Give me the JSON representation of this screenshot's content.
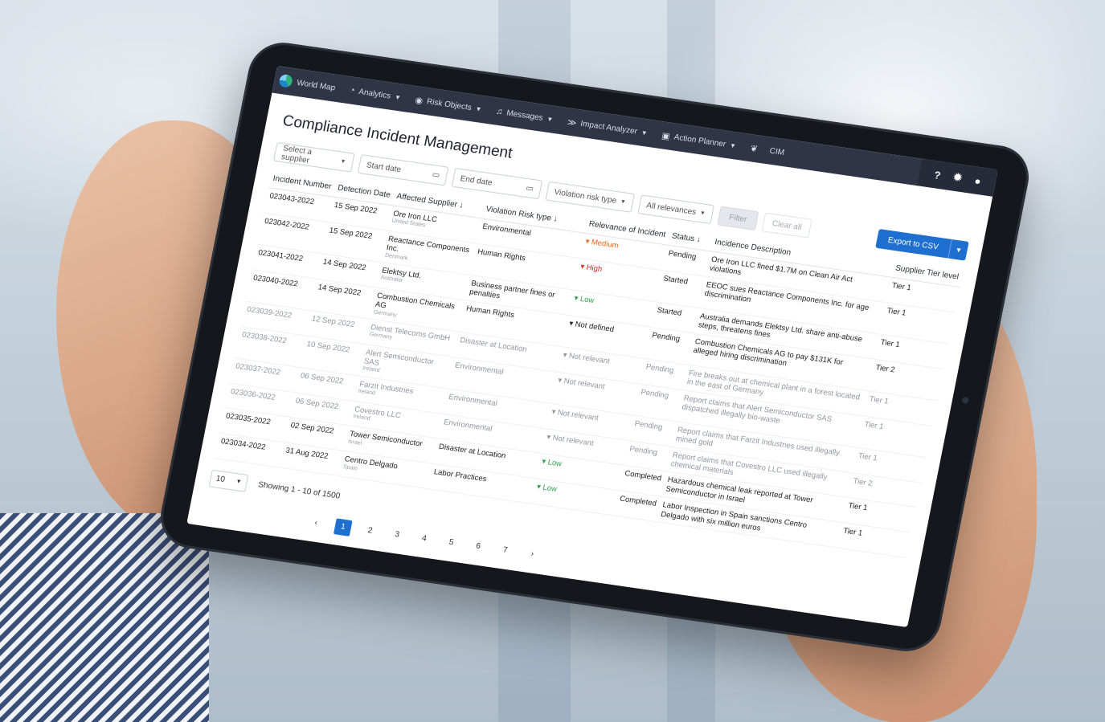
{
  "nav": {
    "items": [
      {
        "label": "World Map",
        "icon": "globe-logo",
        "caret": false
      },
      {
        "label": "Analytics",
        "icon": "pie-chart-icon",
        "caret": true
      },
      {
        "label": "Risk Objects",
        "icon": "eye-icon",
        "caret": true
      },
      {
        "label": "Messages",
        "icon": "bell-icon",
        "caret": true
      },
      {
        "label": "Impact Analyzer",
        "icon": "impact-icon",
        "caret": true
      },
      {
        "label": "Action Planner",
        "icon": "clipboard-icon",
        "caret": true
      },
      {
        "label": "CIM",
        "icon": "leaf-icon",
        "caret": false
      }
    ],
    "right_icons": [
      "help-icon",
      "settings-icon",
      "user-icon"
    ]
  },
  "page": {
    "title": "Compliance Incident Management"
  },
  "filters": {
    "supplier": "Select a supplier",
    "start_date": "Start date",
    "end_date": "End date",
    "violation_type": "Violation risk type",
    "relevance": "All relevances",
    "filter_button": "Filter",
    "clear_button": "Clear all",
    "export_button": "Export to CSV"
  },
  "table": {
    "columns": [
      "Incident Number",
      "Detection Date",
      "Affected Supplier",
      "Violation Risk type",
      "Relevance of Incident",
      "Status",
      "Incidence Description",
      "Supplier Tier level"
    ],
    "rows": [
      {
        "number": "023043-2022",
        "date": "15 Sep 2022",
        "supplier": "Ore Iron LLC",
        "country": "United States",
        "violation": "Environmental",
        "relevance": "Medium",
        "rel_class": "medium",
        "status": "Pending",
        "description": "Ore Iron LLC fined $1.7M on Clean Air Act violations",
        "tier": "Tier 1",
        "muted": false
      },
      {
        "number": "023042-2022",
        "date": "15 Sep 2022",
        "supplier": "Reactance Components Inc.",
        "country": "Denmark",
        "violation": "Human Rights",
        "relevance": "High",
        "rel_class": "high",
        "status": "Started",
        "description": "EEOC sues Reactance Components Inc. for age discrimination",
        "tier": "Tier 1",
        "muted": false
      },
      {
        "number": "023041-2022",
        "date": "14 Sep 2022",
        "supplier": "Elektsy Ltd.",
        "country": "Australia",
        "violation": "Business partner fines or penalties",
        "relevance": "Low",
        "rel_class": "low",
        "status": "Started",
        "description": "Australia demands Elektsy Ltd. share anti-abuse steps, threatens fines",
        "tier": "Tier 1",
        "muted": false
      },
      {
        "number": "023040-2022",
        "date": "14 Sep 2022",
        "supplier": "Combustion Chemicals AG",
        "country": "Germany",
        "violation": "Human Rights",
        "relevance": "Not defined",
        "rel_class": "",
        "status": "Pending",
        "description": "Combustion Chemicals AG to pay $131K for alleged hiring discrimination",
        "tier": "Tier 2",
        "muted": false
      },
      {
        "number": "023039-2022",
        "date": "12 Sep 2022",
        "supplier": "Dienst Telecoms GmbH",
        "country": "Germany",
        "violation": "Disaster at Location",
        "relevance": "Not relevant",
        "rel_class": "",
        "status": "Pending",
        "description": "Fire breaks out at chemical plant in a forest located in the east of Germany",
        "tier": "Tier 1",
        "muted": true
      },
      {
        "number": "023038-2022",
        "date": "10 Sep 2022",
        "supplier": "Alert Semiconductor SAS",
        "country": "Ireland",
        "violation": "Environmental",
        "relevance": "Not relevant",
        "rel_class": "",
        "status": "Pending",
        "description": "Report claims that Alert Semiconductor SAS dispatched illegally bio-waste",
        "tier": "Tier 1",
        "muted": true
      },
      {
        "number": "023037-2022",
        "date": "06 Sep 2022",
        "supplier": "Farzit Industries",
        "country": "Ireland",
        "violation": "Environmental",
        "relevance": "Not relevant",
        "rel_class": "",
        "status": "Pending",
        "description": "Report claims that Farzit Industries used illegally mined gold",
        "tier": "Tier 1",
        "muted": true
      },
      {
        "number": "023036-2022",
        "date": "06 Sep 2022",
        "supplier": "Covestro LLC",
        "country": "Ireland",
        "violation": "Environmental",
        "relevance": "Not relevant",
        "rel_class": "",
        "status": "Pending",
        "description": "Report claims that Covestro LLC used illegally chemical materials",
        "tier": "Tier 2",
        "muted": true
      },
      {
        "number": "023035-2022",
        "date": "02 Sep 2022",
        "supplier": "Tower Semiconductor",
        "country": "Israel",
        "violation": "Disaster at Location",
        "relevance": "Low",
        "rel_class": "low",
        "status": "Completed",
        "description": "Hazardous chemical leak reported at Tower Semiconductor in Israel",
        "tier": "Tier 1",
        "muted": false
      },
      {
        "number": "023034-2022",
        "date": "31 Aug 2022",
        "supplier": "Centro Delgado",
        "country": "Spain",
        "violation": "Labor Practices",
        "relevance": "Low",
        "rel_class": "low",
        "status": "Completed",
        "description": "Labor Inspection in Spain sanctions Centro Delgado with six million euros",
        "tier": "Tier 1",
        "muted": false
      }
    ]
  },
  "footer": {
    "per_page": "10",
    "showing": "Showing 1 - 10 of 1500",
    "pages": [
      "1",
      "2",
      "3",
      "4",
      "5",
      "6",
      "7"
    ],
    "active_page": "1"
  }
}
